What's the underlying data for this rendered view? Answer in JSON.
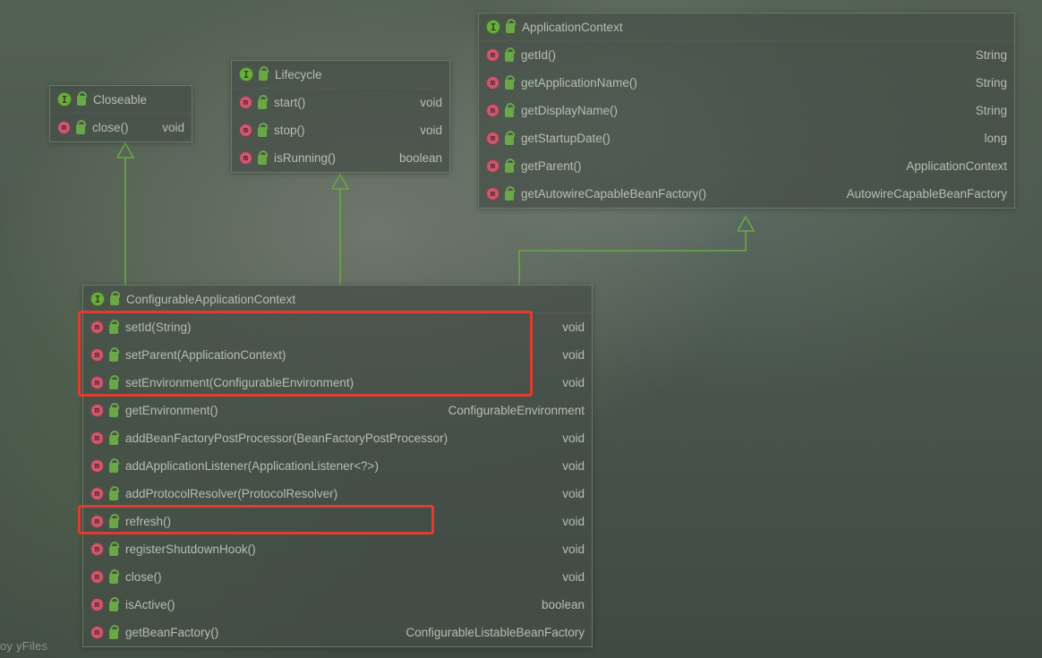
{
  "interfaces": {
    "closeable": {
      "title": "Closeable",
      "methods": [
        {
          "name": "close()",
          "returns": "void"
        }
      ]
    },
    "lifecycle": {
      "title": "Lifecycle",
      "methods": [
        {
          "name": "start()",
          "returns": "void"
        },
        {
          "name": "stop()",
          "returns": "void"
        },
        {
          "name": "isRunning()",
          "returns": "boolean"
        }
      ]
    },
    "applicationContext": {
      "title": "ApplicationContext",
      "methods": [
        {
          "name": "getId()",
          "returns": "String"
        },
        {
          "name": "getApplicationName()",
          "returns": "String"
        },
        {
          "name": "getDisplayName()",
          "returns": "String"
        },
        {
          "name": "getStartupDate()",
          "returns": "long"
        },
        {
          "name": "getParent()",
          "returns": "ApplicationContext"
        },
        {
          "name": "getAutowireCapableBeanFactory()",
          "returns": "AutowireCapableBeanFactory"
        }
      ]
    },
    "configurableApplicationContext": {
      "title": "ConfigurableApplicationContext",
      "methods": [
        {
          "name": "setId(String)",
          "returns": "void"
        },
        {
          "name": "setParent(ApplicationContext)",
          "returns": "void"
        },
        {
          "name": "setEnvironment(ConfigurableEnvironment)",
          "returns": "void"
        },
        {
          "name": "getEnvironment()",
          "returns": "ConfigurableEnvironment"
        },
        {
          "name": "addBeanFactoryPostProcessor(BeanFactoryPostProcessor)",
          "returns": "void"
        },
        {
          "name": "addApplicationListener(ApplicationListener<?>)",
          "returns": "void"
        },
        {
          "name": "addProtocolResolver(ProtocolResolver)",
          "returns": "void"
        },
        {
          "name": "refresh()",
          "returns": "void"
        },
        {
          "name": "registerShutdownHook()",
          "returns": "void"
        },
        {
          "name": "close()",
          "returns": "void"
        },
        {
          "name": "isActive()",
          "returns": "boolean"
        },
        {
          "name": "getBeanFactory()",
          "returns": "ConfigurableListableBeanFactory"
        }
      ]
    }
  },
  "highlights": [
    {
      "target": "config-methods-0-2"
    },
    {
      "target": "config-method-refresh"
    }
  ],
  "watermark": "oy yFiles"
}
